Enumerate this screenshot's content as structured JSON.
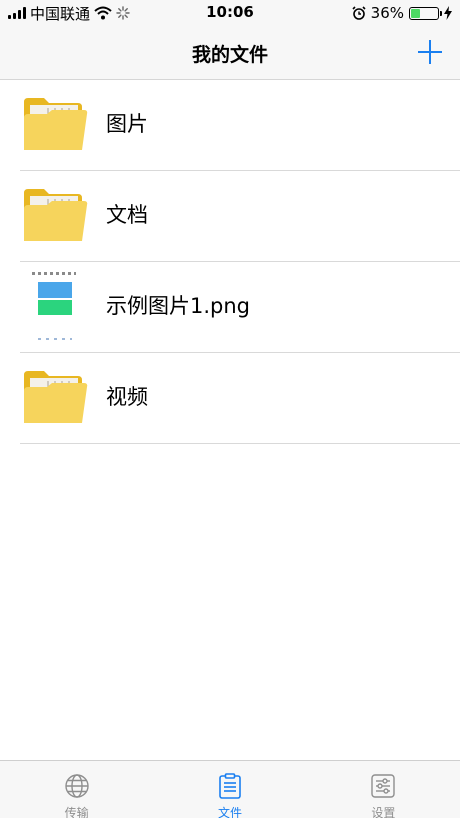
{
  "status_bar": {
    "carrier": "中国联通",
    "time": "10:06",
    "battery_text": "36%",
    "battery_level": 0.36,
    "battery_color": "#4cd964"
  },
  "nav": {
    "title": "我的文件",
    "add_icon": "plus-icon",
    "accent_color": "#1a7ff0"
  },
  "files": [
    {
      "name": "图片",
      "type": "folder",
      "icon": "folder-icon"
    },
    {
      "name": "文档",
      "type": "folder",
      "icon": "folder-icon"
    },
    {
      "name": "示例图片1.png",
      "type": "image",
      "icon": "image-thumbnail"
    },
    {
      "name": "视频",
      "type": "folder",
      "icon": "folder-icon"
    }
  ],
  "tabs": [
    {
      "label": "传输",
      "icon": "globe-icon",
      "active": false
    },
    {
      "label": "文件",
      "icon": "clipboard-icon",
      "active": true
    },
    {
      "label": "设置",
      "icon": "sliders-icon",
      "active": false
    }
  ]
}
